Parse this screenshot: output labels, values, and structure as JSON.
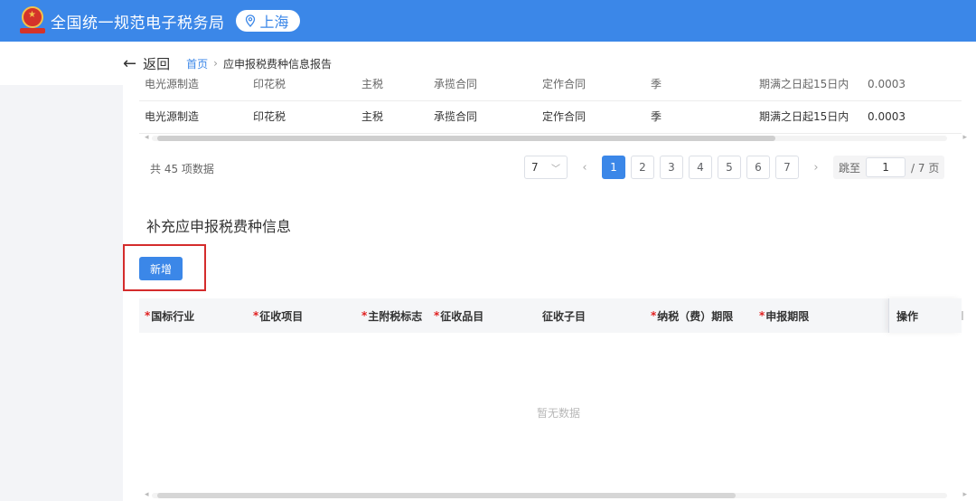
{
  "header": {
    "app_title": "全国统一规范电子税务局",
    "region": "上海",
    "colors": {
      "header_bg": "#3b87e8",
      "emblem_red": "#d4332a",
      "emblem_gold": "#f3c24a"
    }
  },
  "subbar": {
    "back_label": "返回",
    "breadcrumb": {
      "home": "首页",
      "separator": "›",
      "current": "应申报税费种信息报告"
    }
  },
  "upper_table": {
    "rows": [
      {
        "industry": "电光源制造",
        "item": "印花税",
        "tax_type": "主税",
        "category": "承揽合同",
        "sub_item": "定作合同",
        "period": "季",
        "declare_period": "期满之日起15日内",
        "rate": "0.0003"
      },
      {
        "industry": "电光源制造",
        "item": "印花税",
        "tax_type": "主税",
        "category": "承揽合同",
        "sub_item": "定作合同",
        "period": "季",
        "declare_period": "期满之日起15日内",
        "rate": "0.0003"
      }
    ],
    "pagination": {
      "total_text": "共 45 项数据",
      "page_size": "7",
      "pages": [
        "1",
        "2",
        "3",
        "4",
        "5",
        "6",
        "7"
      ],
      "current_page_index": 0,
      "jump_label": "跳至",
      "jump_value": "1",
      "jump_suffix": "/ 7 页"
    }
  },
  "supplement": {
    "title": "补充应申报税费种信息",
    "add_button": "新增",
    "required_mark": "*",
    "columns": [
      {
        "label": "国标行业",
        "required": true
      },
      {
        "label": "征收项目",
        "required": true
      },
      {
        "label": "主附税标志",
        "required": true
      },
      {
        "label": "征收品目",
        "required": true
      },
      {
        "label": "征收子目",
        "required": false
      },
      {
        "label": "纳税（费）期限",
        "required": true
      },
      {
        "label": "申报期限",
        "required": true
      }
    ],
    "action_column": "操作",
    "empty_text": "暂无数据",
    "highlight_color": "#d42c2c"
  }
}
